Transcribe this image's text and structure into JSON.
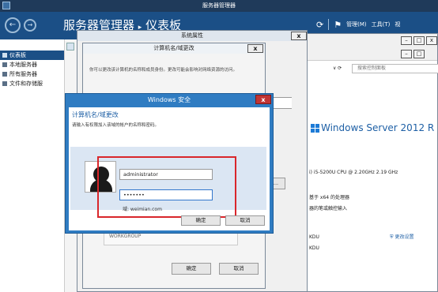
{
  "app": {
    "title": "服务器管理器"
  },
  "breadcrumb": {
    "root": "服务器管理器",
    "sep": "▸",
    "current": "仪表板"
  },
  "topbar": {
    "nav_back": "←",
    "nav_forward": "→",
    "refresh_icon": "⟳",
    "menu_manage": "管理(M)",
    "menu_tools": "工具(T)",
    "menu_view": "视"
  },
  "sidebar": {
    "items": [
      {
        "label": "仪表板"
      },
      {
        "label": "本地服务器"
      },
      {
        "label": "所有服务器"
      },
      {
        "label": "文件和存储服"
      }
    ]
  },
  "control_panel": {
    "search_placeholder": "搜索控制面板",
    "brand": "Windows Server 2012 R",
    "cpu": "i) i5-5200U CPU @ 2.20GHz 2.19 GHz",
    "os_type": "基于 x64 的处理器",
    "touch": "器的笔或触控输入",
    "workgroup_a": "KDU",
    "workgroup_b": "KDU",
    "change_settings": "更改设置",
    "nav_arrow": "∨ ⟳"
  },
  "system_properties": {
    "title": "系统属性"
  },
  "computer_name": {
    "title": "计算机名/域更改",
    "desc": "你可以更改该计算机的名称和成员身份。更改可能会影响对网络资源的访问。",
    "partial": "ng",
    "workgroup": "WORKGROUP",
    "ok": "确定",
    "cancel": "取消"
  },
  "security": {
    "title": "Windows 安全",
    "heading": "计算机名/域更改",
    "subtitle": "请输入有权限加入该域的帐户的名称和密码。",
    "username": "administrator",
    "password": "•••••••",
    "domain_label": "域: weimian.com",
    "ok": "确定",
    "cancel": "取消",
    "close": "x"
  }
}
